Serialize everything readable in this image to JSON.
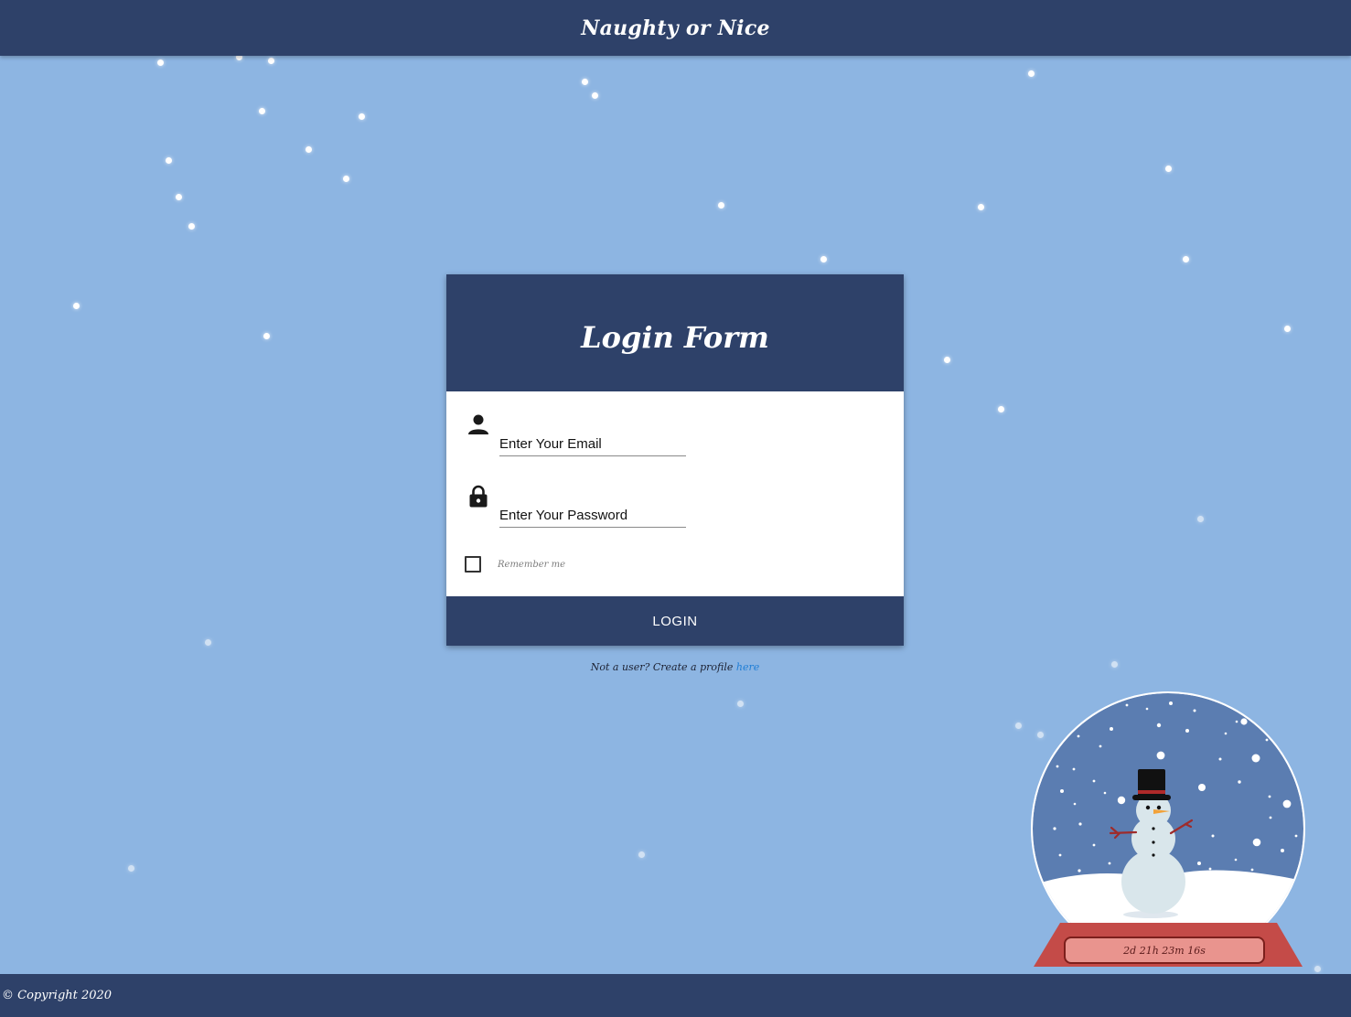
{
  "header": {
    "title": "Naughty or Nice"
  },
  "form": {
    "title": "Login Form",
    "email_placeholder": "Enter Your Email",
    "password_placeholder": "Enter Your Password",
    "remember_label": "Remember me",
    "login_label": "LOGIN"
  },
  "signup": {
    "prefix": "Not a user? Create a profile ",
    "link_label": "here"
  },
  "globe": {
    "countdown": "2d 21h 23m 16s"
  },
  "footer": {
    "copyright": "© Copyright 2020"
  },
  "colors": {
    "primary": "#2e4169",
    "background": "#8db5e2",
    "globe_sky": "#5b7db1",
    "globe_base": "#c44b48",
    "countdown_bg": "#e9948e",
    "link": "#1f7ed6"
  },
  "icons": {
    "email": "person-icon",
    "password": "lock-icon"
  }
}
